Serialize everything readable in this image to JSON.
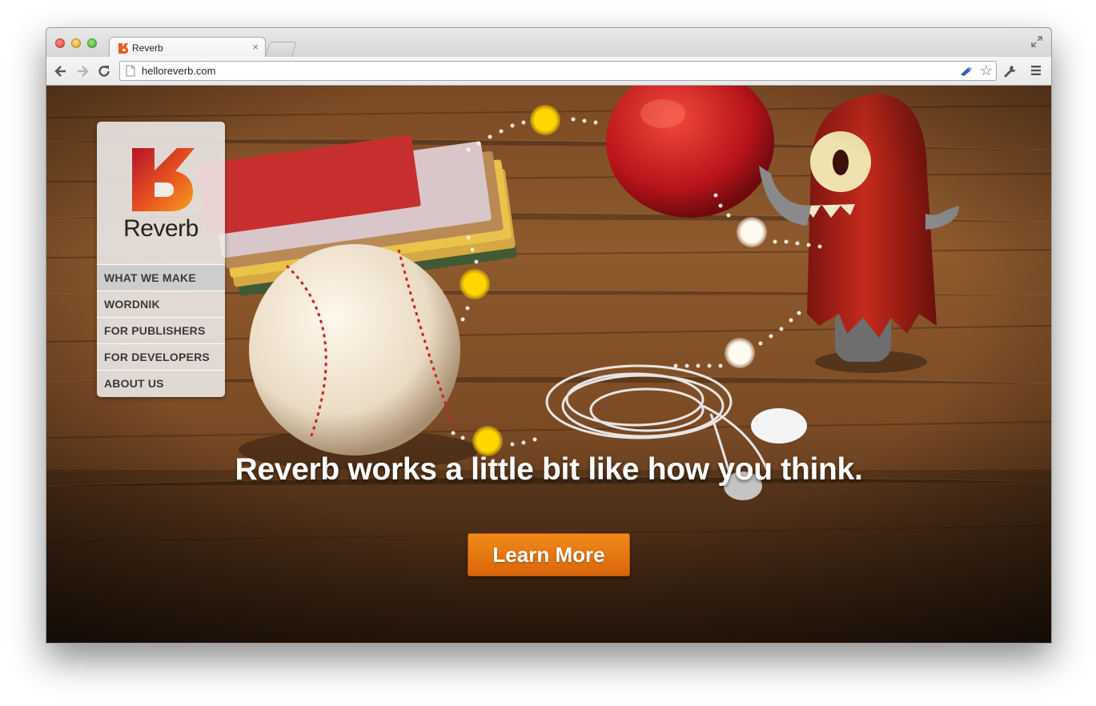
{
  "browser": {
    "tab_title": "Reverb",
    "tab_close": "×",
    "url": "helloreverb.com"
  },
  "sidebar": {
    "logo_text": "Reverb",
    "items": [
      {
        "label": "WHAT WE MAKE",
        "active": true
      },
      {
        "label": "WORDNIK"
      },
      {
        "label": "FOR PUBLISHERS"
      },
      {
        "label": "FOR DEVELOPERS"
      },
      {
        "label": "ABOUT US"
      }
    ]
  },
  "hero": {
    "headline": "Reverb works a little bit like how you think.",
    "cta_label": "Learn More"
  },
  "colors": {
    "brand_orange": "#e8760f",
    "dot_yellow": "#ffd600",
    "dot_white": "#fff8e8"
  }
}
